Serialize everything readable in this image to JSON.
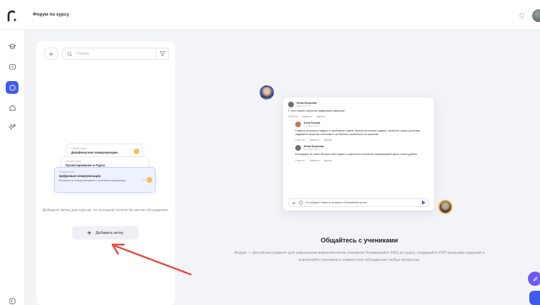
{
  "header": {
    "title": "Форум по курсу"
  },
  "sidebar": {
    "items": [
      {
        "icon": "graduation-cap-icon"
      },
      {
        "icon": "chat-icon"
      },
      {
        "icon": "circle-icon",
        "active": true
      },
      {
        "icon": "home-icon"
      },
      {
        "icon": "sparkles-icon"
      },
      {
        "icon": "settings-icon"
      }
    ]
  },
  "left_panel": {
    "search_placeholder": "Поиск",
    "preview_cards": [
      {
        "meta": "Общий канал",
        "title": "Дизайнерские коммуникации"
      },
      {
        "meta": "Общий канал",
        "title": "Проектирование в Figma"
      },
      {
        "meta": "Общий канал",
        "title": "Цифровые коммуникации",
        "desc": "Вопросы по коммуникациям и полезная информация",
        "time": "3 ч"
      }
    ],
    "empty_text": "Добавьте ветки для курсов, по которым хотели бы вести обсуждения.",
    "add_button_label": "Добавить ветку"
  },
  "preview": {
    "messages": [
      {
        "name": "Юлия Борисова",
        "time": "Вчера в 17:38",
        "text": "С чего начать обучение цифровым навыкам?"
      },
      {
        "name": "Алла Попова",
        "time": "Сегодня в 10:14",
        "text": "Главное регулярно видеть и пробовать в деле: берите реальные задачи, смотрите чужие решения, задавайте вопросы коллегам и не бойтесь ошибаться на практике."
      },
      {
        "name": "Юлия Борисова",
        "time": "Сегодня в 10:40",
        "text": "Благодарю за ответ! Вопрос был закрыт, а делиться полезной информацией здесь очень удобно."
      }
    ],
    "actions": [
      "Ответить",
      "Нравится",
      "Удалить"
    ],
    "input_placeholder": "Не забудьте ответить на вопрос в ближайшее время"
  },
  "hero": {
    "title": "Общайтесь с учениками",
    "desc": "Форум — крутой инструмент для повышения вовлечённости учеников! Размещайте FAQ по курсу, создавайте P2P механики заданий и вовлекайте учеников в совместное обсуждение любых вопросов."
  },
  "colors": {
    "accent": "#3f5bf5",
    "arrow": "#e8483c"
  }
}
